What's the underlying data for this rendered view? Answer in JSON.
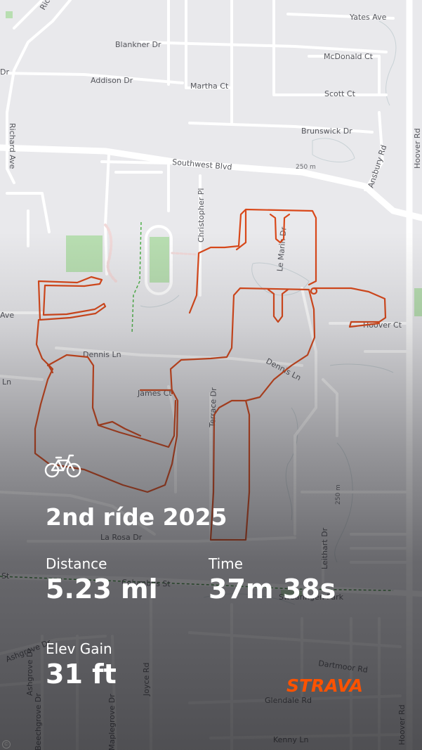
{
  "activity": {
    "title": "2nd ríde 2025",
    "type_icon": "bicycle-icon"
  },
  "stats": {
    "distance": {
      "label": "Distance",
      "value": "5.23 mi"
    },
    "time": {
      "label": "Time",
      "value": "37m 38s"
    },
    "elev_gain": {
      "label": "Elev Gain",
      "value": "31 ft"
    }
  },
  "brand": {
    "name": "STRAVA",
    "color": "#fc5200"
  },
  "colors": {
    "route": "#d9481a",
    "map_background": "#e9e9ec",
    "road": "#ffffff",
    "park": "#b8deb1"
  },
  "map": {
    "streets": [
      "Yates Ave",
      "Blankner Dr",
      "McDonald Ct",
      "Addison Dr",
      "Martha Ct",
      "Scott Ct",
      "Brunswick Dr",
      "Richard Ave",
      "Southwest Blvd",
      "Ansbury Rd",
      "Hoover Rd",
      "Christopher Pl",
      "Ave",
      "Hoover Ct",
      "Dennis Ln",
      "Dennis Ln",
      "Ln",
      "La Rosa Dr",
      "Columbus St",
      "St",
      "Leithart Dr",
      "Ashgrove Dr",
      "Joyce Rd",
      "Dartmoor Rd",
      "Glendale Rd",
      "Beechgrove Dr",
      "Maplegrove Dr",
      "Kenny Ln",
      "Swearingen Park",
      "Hoover Rd",
      "250 m",
      "250 m",
      "Richa",
      "Dr",
      "Terrace Dr",
      "Ashgrove Dr",
      "James Ct",
      "Le Marin Dr"
    ]
  }
}
